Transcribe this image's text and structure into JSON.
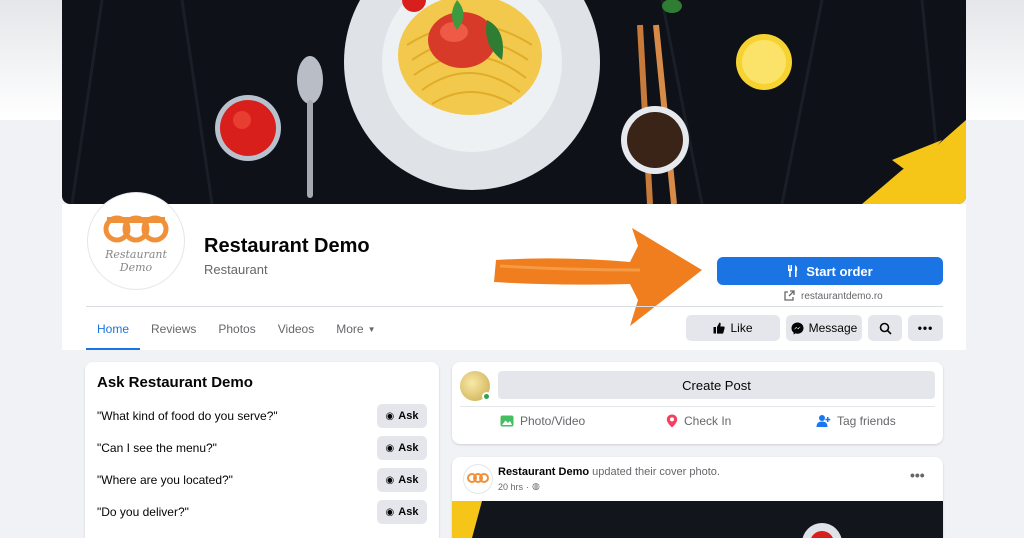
{
  "page": {
    "name": "Restaurant Demo",
    "category": "Restaurant",
    "logo_text": [
      "Restaurant",
      "Demo"
    ]
  },
  "cta": {
    "start_order_label": "Start order",
    "website": "restaurantdemo.ro"
  },
  "tabs": [
    {
      "label": "Home",
      "active": true
    },
    {
      "label": "Reviews"
    },
    {
      "label": "Photos"
    },
    {
      "label": "Videos"
    },
    {
      "label": "More"
    }
  ],
  "actions": {
    "like_label": "Like",
    "message_label": "Message"
  },
  "ask": {
    "title": "Ask Restaurant Demo",
    "button_label": "Ask",
    "questions": [
      "\"What kind of food do you serve?\"",
      "\"Can I see the menu?\"",
      "\"Where are you located?\"",
      "\"Do you deliver?\""
    ]
  },
  "create_post": {
    "placeholder": "Create Post",
    "actions": [
      "Photo/Video",
      "Check In",
      "Tag friends"
    ]
  },
  "post": {
    "author": "Restaurant Demo",
    "action_text": "updated their cover photo.",
    "time": "20 hrs"
  },
  "colors": {
    "accent": "#1b74e4",
    "annotation_arrow": "#f07d1e"
  }
}
